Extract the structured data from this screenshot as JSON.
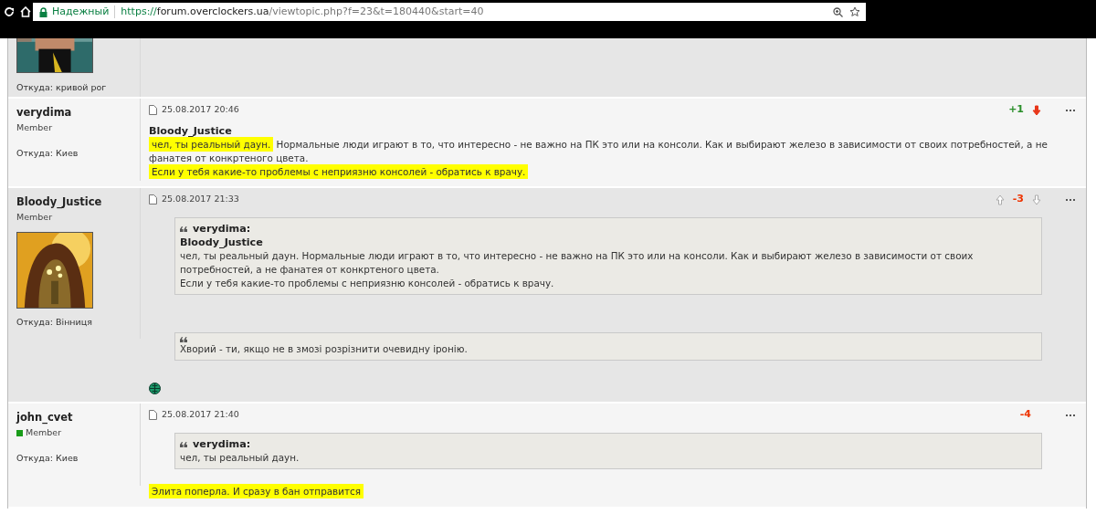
{
  "browser": {
    "security_label": "Надежный",
    "url": {
      "scheme": "https://",
      "host": "forum.overclockers.ua",
      "path": "/viewtopic.php?f=23&t=180440&start=40"
    }
  },
  "posts": [
    {
      "avatar": {
        "kind": "picture"
      },
      "location": "Откуда: кривой рог"
    },
    {
      "author": "verydima",
      "rank": "Member",
      "online": false,
      "location": "Откуда: Киев",
      "date": "25.08.2017 20:46",
      "vote": {
        "score": "+1",
        "positive": true,
        "down_arrow": {
          "voted": true
        }
      },
      "body": [
        {
          "kind": "bold",
          "text": "Bloody_Justice"
        },
        {
          "kind": "para",
          "segments": [
            {
              "text": "чел, ты реальный даун.",
              "highlighted": true
            },
            {
              "text": " Нормальные люди играют в то, что интересно - не важно на ПК это или на консоли. Как и выбирают железо в зависимости от своих потребностей, а не фанатея от конкртеного цвета.",
              "highlighted": false
            }
          ]
        },
        {
          "kind": "para",
          "segments": [
            {
              "text": "Если у тебя какие-то проблемы с неприязню консолей - обратись к врачу.",
              "highlighted": true
            }
          ]
        }
      ]
    },
    {
      "author": "Bloody_Justice",
      "rank": "Member",
      "online": false,
      "avatar": {
        "kind": "picture"
      },
      "location": "Откуда: Вінниця",
      "date": "25.08.2017 21:33",
      "vote": {
        "score": "-3",
        "positive": false,
        "up_arrow": {
          "voted": false
        },
        "down_arrow": {
          "voted": false
        }
      },
      "body": [
        {
          "kind": "quote",
          "author": "verydima:",
          "lines": [
            {
              "kind": "bold",
              "text": "Bloody_Justice"
            },
            {
              "kind": "para",
              "segments": [
                {
                  "text": "чел, ты реальный даун. Нормальные люди играют в то, что интересно - не важно на ПК это или на консоли. Как и выбирают железо в зависимости от своих потребностей, а не фанатея от конкртеного цвета.",
                  "highlighted": false
                }
              ]
            },
            {
              "kind": "para",
              "segments": [
                {
                  "text": "Если у тебя какие-то проблемы с неприязню консолей - обратись к врачу.",
                  "highlighted": false
                }
              ]
            }
          ]
        },
        {
          "kind": "quote",
          "lines": [
            {
              "kind": "para",
              "segments": [
                {
                  "text": "Хворий - ти, якщо не в змозі розрізнити очевидну іронію.",
                  "highlighted": false
                }
              ]
            }
          ]
        },
        {
          "kind": "badge"
        }
      ]
    },
    {
      "author": "john_cvet",
      "rank": "Member",
      "online": true,
      "location": "Откуда: Киев",
      "date": "25.08.2017 21:40",
      "vote": {
        "score": "-4",
        "positive": false
      },
      "body": [
        {
          "kind": "quote",
          "author": "verydima:",
          "lines": [
            {
              "kind": "para",
              "segments": [
                {
                  "text": "чел, ты реальный даун.",
                  "highlighted": false
                }
              ]
            }
          ]
        },
        {
          "kind": "para",
          "segments": [
            {
              "text": "Элита поперла. И сразу в бан отправится",
              "highlighted": true
            }
          ]
        }
      ]
    }
  ]
}
